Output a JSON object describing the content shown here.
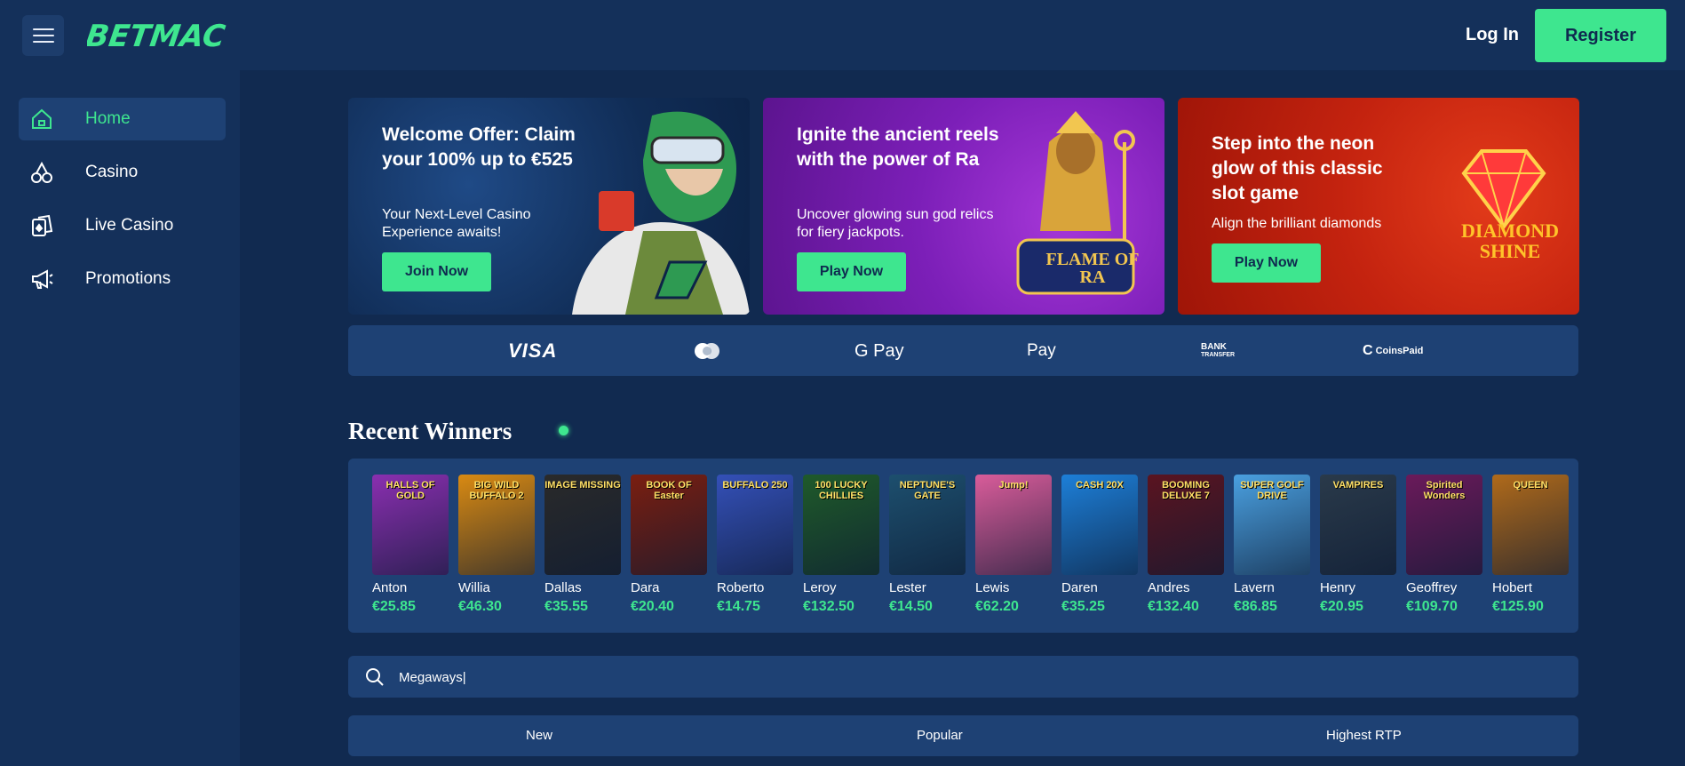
{
  "header": {
    "brand": "BETMAC",
    "login_label": "Log In",
    "register_label": "Register"
  },
  "sidebar": {
    "items": [
      {
        "label": "Home",
        "icon": "home-icon",
        "active": true
      },
      {
        "label": "Casino",
        "icon": "cherries-icon",
        "active": false
      },
      {
        "label": "Live Casino",
        "icon": "cards-icon",
        "active": false
      },
      {
        "label": "Promotions",
        "icon": "megaphone-icon",
        "active": false
      }
    ]
  },
  "banners": [
    {
      "title": "Welcome Offer: Claim your 100% up to €525",
      "subtitle": "Your Next-Level Casino Experience awaits!",
      "button": "Join Now"
    },
    {
      "title": "Ignite the ancient reels with the power of Ra",
      "subtitle": "Uncover glowing sun god relics for fiery jackpots.",
      "button": "Play Now",
      "art_text": "FLAME OF RA"
    },
    {
      "title": "Step into the neon glow of this classic slot game",
      "subtitle": "Align the brilliant diamonds",
      "button": "Play Now",
      "art_text": "DIAMOND SHINE"
    }
  ],
  "payments": {
    "visa": "VISA",
    "mastercard": "mastercard-icon",
    "gpay": "G Pay",
    "applepay": " Pay",
    "bank_line1": "BANK",
    "bank_line2": "TRANSFER",
    "coinspaid": "CoinsPaid"
  },
  "recent_winners": {
    "title": "Recent Winners",
    "winners": [
      {
        "name": "Anton",
        "amount": "€25.85",
        "game": "HALLS OF GOLD",
        "color": "#8a2fb0"
      },
      {
        "name": "Willia",
        "amount": "€46.30",
        "game": "BIG WILD BUFFALO 2",
        "color": "#d98a12"
      },
      {
        "name": "Dallas",
        "amount": "€35.55",
        "game": "IMAGE MISSING",
        "color": "#2a2a2a"
      },
      {
        "name": "Dara",
        "amount": "€20.40",
        "game": "BOOK OF Easter",
        "color": "#7a1e10"
      },
      {
        "name": "Roberto",
        "amount": "€14.75",
        "game": "BUFFALO 250",
        "color": "#3450b8"
      },
      {
        "name": "Leroy",
        "amount": "€132.50",
        "game": "100 LUCKY CHILLIES",
        "color": "#1f5a2a"
      },
      {
        "name": "Lester",
        "amount": "€14.50",
        "game": "NEPTUNE'S GATE",
        "color": "#1d4f6e"
      },
      {
        "name": "Lewis",
        "amount": "€62.20",
        "game": "Jump!",
        "color": "#d95c9a"
      },
      {
        "name": "Daren",
        "amount": "€35.25",
        "game": "CASH 20X",
        "color": "#1d7fd8"
      },
      {
        "name": "Andres",
        "amount": "€132.40",
        "game": "BOOMING DELUXE 7",
        "color": "#5a1420"
      },
      {
        "name": "Lavern",
        "amount": "€86.85",
        "game": "SUPER GOLF DRIVE",
        "color": "#4aa0e0"
      },
      {
        "name": "Henry",
        "amount": "€20.95",
        "game": "VAMPIRES",
        "color": "#2a3a4a"
      },
      {
        "name": "Geoffrey",
        "amount": "€109.70",
        "game": "Spirited Wonders",
        "color": "#6a1a5a"
      },
      {
        "name": "Hobert",
        "amount": "€125.90",
        "game": "QUEEN",
        "color": "#b06a1a"
      }
    ]
  },
  "search": {
    "value": "Megaways|"
  },
  "tabs": [
    "New",
    "Popular",
    "Highest RTP"
  ]
}
